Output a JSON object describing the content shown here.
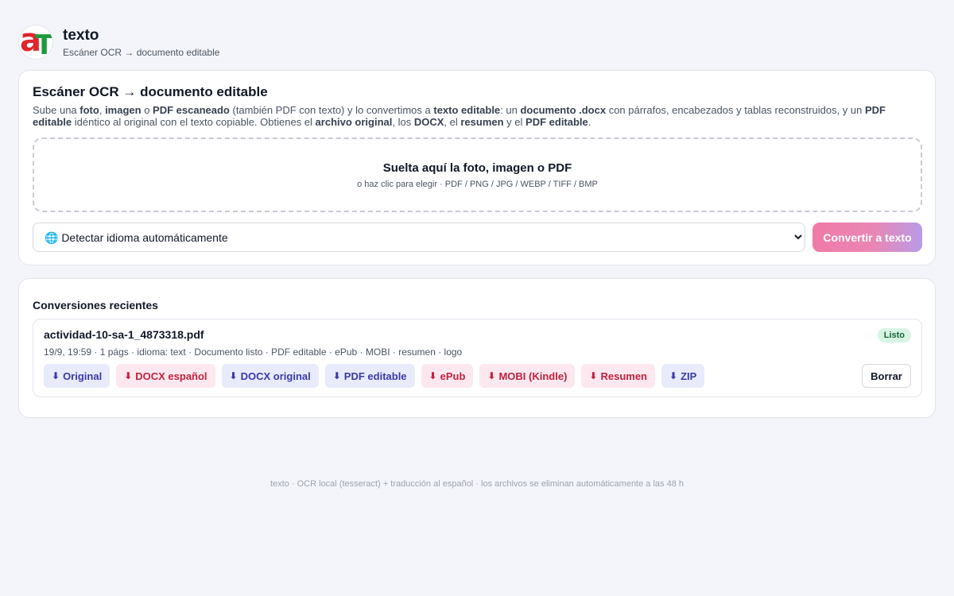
{
  "brand": {
    "logo_a": "a",
    "logo_t": "T",
    "title": "texto",
    "subtitle": "Escáner OCR → documento editable"
  },
  "upload": {
    "title": "Escáner OCR → documento editable",
    "desc": [
      {
        "t": "Sube una ",
        "b": false
      },
      {
        "t": "foto",
        "b": true
      },
      {
        "t": ", ",
        "b": false
      },
      {
        "t": "imagen",
        "b": true
      },
      {
        "t": " o ",
        "b": false
      },
      {
        "t": "PDF escaneado",
        "b": true
      },
      {
        "t": " (también PDF con texto) y lo convertimos a ",
        "b": false
      },
      {
        "t": "texto editable",
        "b": true
      },
      {
        "t": ": un ",
        "b": false
      },
      {
        "t": "documento .docx",
        "b": true
      },
      {
        "t": " con párrafos, encabezados y tablas reconstruidos, y un ",
        "b": false
      },
      {
        "t": "PDF editable",
        "b": true
      },
      {
        "t": " idéntico al original con el texto copiable. Obtienes el ",
        "b": false
      },
      {
        "t": "archivo original",
        "b": true
      },
      {
        "t": ", los ",
        "b": false
      },
      {
        "t": "DOCX",
        "b": true
      },
      {
        "t": ", el ",
        "b": false
      },
      {
        "t": "resumen",
        "b": true
      },
      {
        "t": " y el ",
        "b": false
      },
      {
        "t": "PDF editable",
        "b": true
      },
      {
        "t": ".",
        "b": false
      }
    ],
    "dropzone_title": "Suelta aquí la foto, imagen o PDF",
    "dropzone_sub": "o haz clic para elegir · PDF / PNG / JPG / WEBP / TIFF / BMP",
    "language_selected": "🌐 Detectar idioma automáticamente",
    "convert_label": "Convertir a texto"
  },
  "recent": {
    "title": "Conversiones recientes",
    "items": [
      {
        "file_name": "actividad-10-sa-1_4873318.pdf",
        "status": "Listo",
        "meta": "19/9, 19:59 · 1 págs · idioma: text · Documento listo · PDF editable · ePub · MOBI · resumen · logo",
        "download_icon": "⬇",
        "actions": [
          {
            "label": "Original",
            "style": "blue",
            "name": "download-original-button"
          },
          {
            "label": "DOCX español",
            "style": "red",
            "name": "download-docx-spanish-button"
          },
          {
            "label": "DOCX original",
            "style": "blue",
            "name": "download-docx-original-button"
          },
          {
            "label": "PDF editable",
            "style": "blue",
            "name": "download-pdf-editable-button"
          },
          {
            "label": "ePub",
            "style": "red",
            "name": "download-epub-button"
          },
          {
            "label": "MOBI (Kindle)",
            "style": "red",
            "name": "download-mobi-button"
          },
          {
            "label": "Resumen",
            "style": "red",
            "name": "download-summary-button"
          },
          {
            "label": "ZIP",
            "style": "blue",
            "name": "download-zip-button"
          }
        ],
        "delete_label": "Borrar"
      }
    ]
  },
  "footer": "texto · OCR local (tesseract) + traducción al español · los archivos se eliminan automáticamente a las 48 h",
  "colors": {
    "accent_pink": "#f07aa6",
    "accent_violet": "#b89be8",
    "link_blue": "#3b3aa8",
    "link_red": "#c0223e",
    "status_green": "#166534"
  }
}
